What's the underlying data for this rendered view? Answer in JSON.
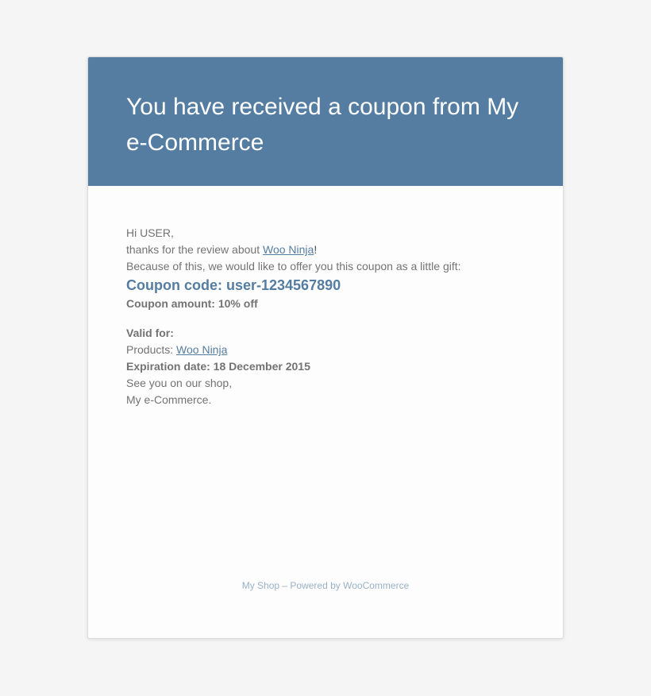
{
  "header": {
    "title": "You have received a coupon from My e-Commerce"
  },
  "greeting": {
    "hi": "Hi USER,",
    "thanks_prefix": "thanks for the review about ",
    "product_link": "Woo Ninja",
    "thanks_suffix": "!",
    "offer": "Because of this, we would like to offer you this coupon as a little gift:"
  },
  "coupon": {
    "code": "Coupon code: user-1234567890",
    "amount": "Coupon amount: 10% off",
    "valid_label": "Valid for:",
    "products_prefix": "Products: ",
    "products_link": "Woo Ninja",
    "expiration": "Expiration date: 18 December 2015"
  },
  "closing": {
    "see_you": "See you on our shop,",
    "signature": "My e-Commerce."
  },
  "footer": {
    "text": "My Shop – Powered by WooCommerce"
  },
  "colors": {
    "header_bg": "#557da1",
    "link": "#557da1",
    "text": "#737373",
    "footer_text": "#99b1c7",
    "page_bg": "#f5f5f5"
  }
}
